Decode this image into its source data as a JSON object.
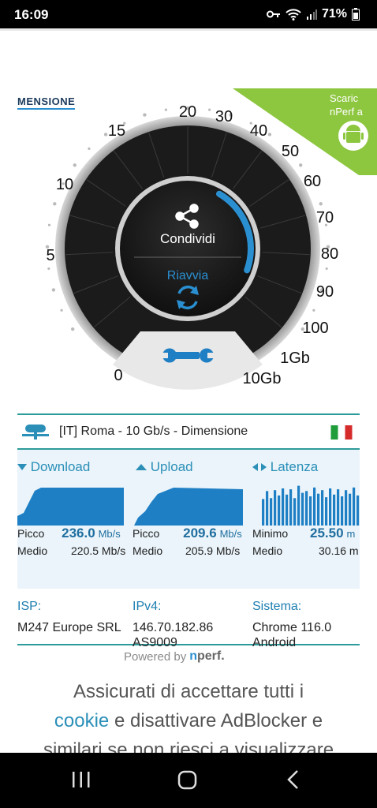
{
  "status": {
    "time": "16:09",
    "battery": "71%"
  },
  "brand": {
    "logo_text": "MENSIONE"
  },
  "promo": {
    "line1": "Scaric",
    "line2": "nPerf a"
  },
  "gauge": {
    "scale_labels": [
      "0",
      "5",
      "10",
      "15",
      "20",
      "30",
      "40",
      "50",
      "60",
      "70",
      "80",
      "90",
      "100",
      "1Gb",
      "10Gb"
    ],
    "share_label": "Condividi",
    "restart_label": "Riavvia",
    "progress": 0.25
  },
  "server": {
    "label": "[IT] Roma - 10 Gb/s - Dimensione",
    "flag": "italy-flag"
  },
  "download": {
    "title": "Download",
    "peak_label": "Picco",
    "peak_value": "236.0",
    "peak_unit": "Mb/s",
    "avg_label": "Medio",
    "avg_value": "220.5 Mb/s"
  },
  "upload": {
    "title": "Upload",
    "peak_label": "Picco",
    "peak_value": "209.6",
    "peak_unit": "Mb/s",
    "avg_label": "Medio",
    "avg_value": "205.9 Mb/s"
  },
  "latency": {
    "title": "Latenza",
    "min_label": "Minimo",
    "min_value": "25.50",
    "min_unit": "m",
    "avg_label": "Medio",
    "avg_value": "30.16 m"
  },
  "info": {
    "isp_label": "ISP:",
    "isp_value": "M247 Europe SRL",
    "ipv4_label": "IPv4:",
    "ipv4_value1": "146.70.182.86",
    "ipv4_value2": "AS9009",
    "system_label": "Sistema:",
    "system_value1": "Chrome 116.0",
    "system_value2": "Android"
  },
  "powered": {
    "text": "Powered by",
    "brand_n": "n",
    "brand_rest": "perf."
  },
  "notice": {
    "line1": "Assicurati di accettare tutti i",
    "cookie": "cookie",
    "line2_rest": " e disattivare AdBlocker e",
    "line3": "similari se non riesci a visualizzare"
  },
  "colors": {
    "accent": "#2b8fb8",
    "teal_border": "#2e9b9b",
    "promo_green": "#8dc63f",
    "gauge_dark": "#1a1a1a"
  }
}
